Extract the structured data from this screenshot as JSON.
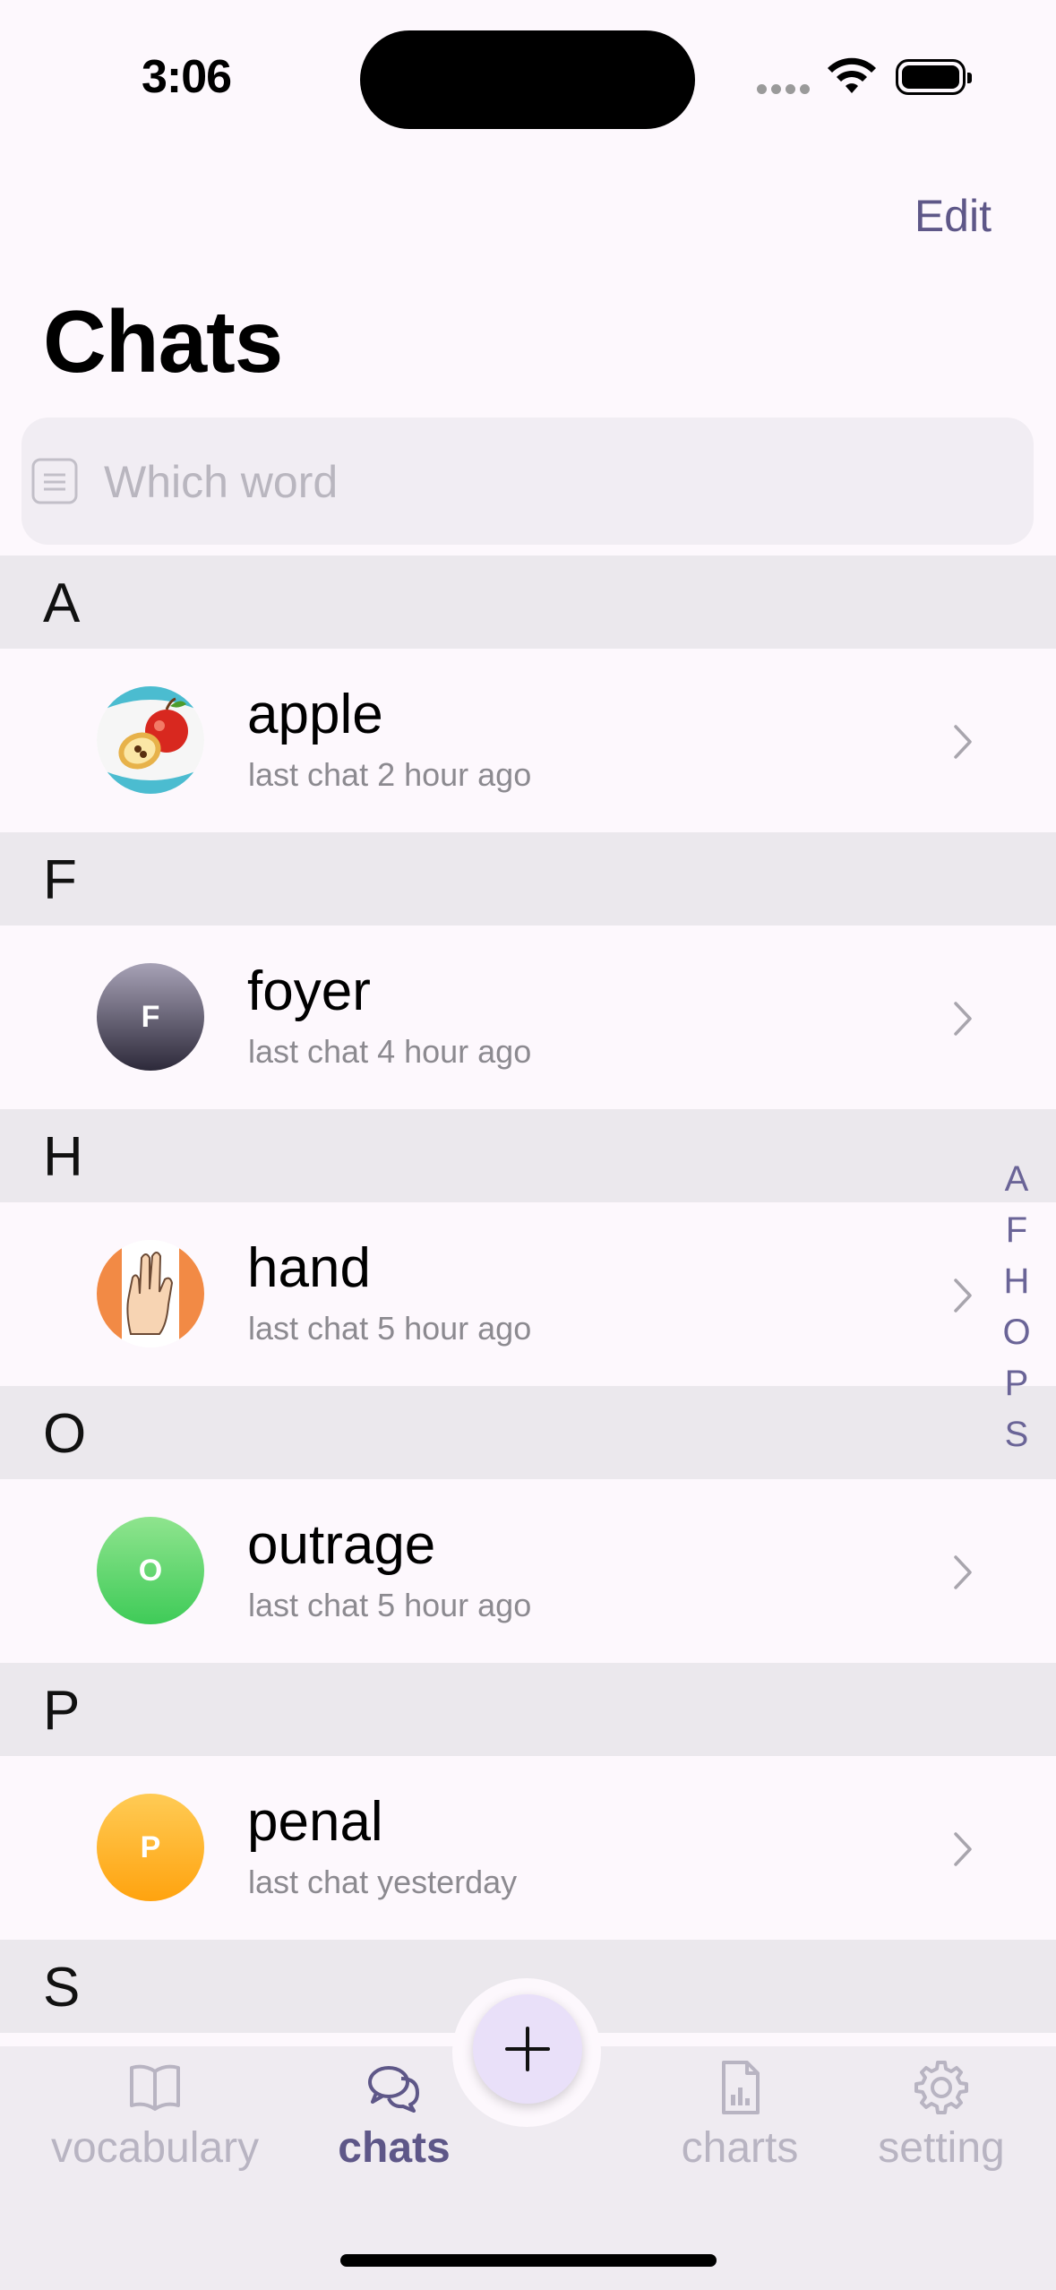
{
  "status_bar": {
    "time": "3:06"
  },
  "header": {
    "edit_label": "Edit",
    "title": "Chats"
  },
  "search": {
    "placeholder": "Which word"
  },
  "sections": [
    {
      "letter": "A",
      "items": [
        {
          "word": "apple",
          "last_chat": "last chat 2 hour ago",
          "avatar": "image",
          "icon": "apple-image-icon"
        }
      ]
    },
    {
      "letter": "F",
      "items": [
        {
          "word": "foyer",
          "last_chat": "last chat 4 hour ago",
          "avatar_letter": "F",
          "color": "#5e5a6e"
        }
      ]
    },
    {
      "letter": "H",
      "items": [
        {
          "word": "hand",
          "last_chat": "last chat 5 hour ago",
          "avatar": "image",
          "icon": "hand-image-icon"
        }
      ]
    },
    {
      "letter": "O",
      "items": [
        {
          "word": "outrage",
          "last_chat": "last chat 5 hour ago",
          "avatar_letter": "O",
          "color": "#5ed66b"
        }
      ]
    },
    {
      "letter": "P",
      "items": [
        {
          "word": "penal",
          "last_chat": "last chat yesterday",
          "avatar_letter": "P",
          "color": "#ffb11f"
        }
      ]
    },
    {
      "letter": "S",
      "items": []
    }
  ],
  "index": [
    "A",
    "F",
    "H",
    "O",
    "P",
    "S"
  ],
  "tabs": [
    {
      "label": "vocabulary",
      "icon": "book-icon",
      "active": false
    },
    {
      "label": "chats",
      "icon": "chat-bubbles-icon",
      "active": true
    },
    {
      "label": "charts",
      "icon": "chart-document-icon",
      "active": false
    },
    {
      "label": "setting",
      "icon": "gear-icon",
      "active": false
    }
  ],
  "colors": {
    "accent": "#5e5788",
    "background": "#fdf8fd",
    "section": "#ebe8ed"
  }
}
